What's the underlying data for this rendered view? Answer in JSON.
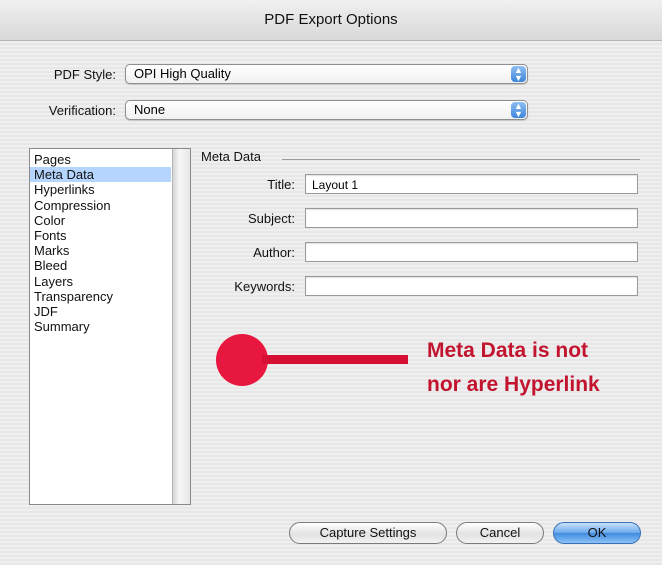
{
  "window": {
    "title": "PDF Export Options"
  },
  "pdf_style": {
    "label": "PDF Style:",
    "value": "OPI High Quality"
  },
  "verification": {
    "label": "Verification:",
    "value": "None"
  },
  "sidebar": {
    "items": [
      {
        "label": "Pages",
        "selected": false
      },
      {
        "label": "Meta Data",
        "selected": true
      },
      {
        "label": "Hyperlinks",
        "selected": false
      },
      {
        "label": "Compression",
        "selected": false
      },
      {
        "label": "Color",
        "selected": false
      },
      {
        "label": "Fonts",
        "selected": false
      },
      {
        "label": "Marks",
        "selected": false
      },
      {
        "label": "Bleed",
        "selected": false
      },
      {
        "label": "Layers",
        "selected": false
      },
      {
        "label": "Transparency",
        "selected": false
      },
      {
        "label": "JDF",
        "selected": false
      },
      {
        "label": "Summary",
        "selected": false
      }
    ]
  },
  "meta_data": {
    "group_title": "Meta Data",
    "title": {
      "label": "Title:",
      "value": "Layout 1"
    },
    "subject": {
      "label": "Subject:",
      "value": ""
    },
    "author": {
      "label": "Author:",
      "value": ""
    },
    "keywords": {
      "label": "Keywords:",
      "value": ""
    }
  },
  "annotation": {
    "line1": "Meta Data is not",
    "line2": "nor are Hyperlink",
    "color": "#e8173f"
  },
  "buttons": {
    "capture_settings": "Capture Settings",
    "cancel": "Cancel",
    "ok": "OK"
  },
  "icons": {
    "popup_arrows": "updown-arrows-icon"
  }
}
